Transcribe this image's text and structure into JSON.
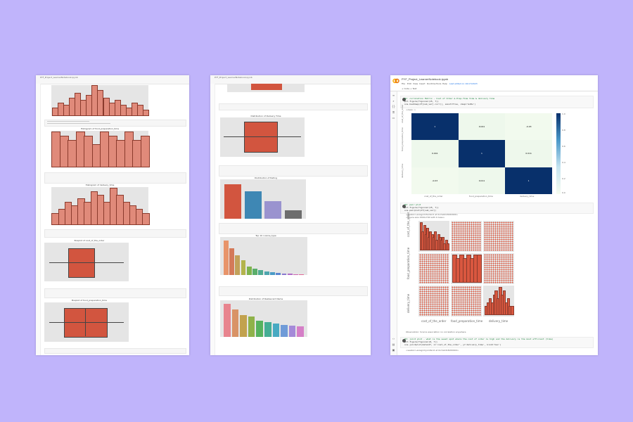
{
  "page1": {
    "title": "PYF_Project_LearnerNotebook.ipynb",
    "chart_titles": [
      "",
      "Histogram of food_preparation_time",
      "Histogram of delivery_time",
      "Boxplot of cost_of_the_order",
      "Boxplot of food_preparation_time"
    ]
  },
  "page2": {
    "title": "PYF_Project_LearnerNotebook.ipynb",
    "chart_titles": [
      "Distribution of Delivery Time",
      "Distribution of Rating",
      "Top 10 cuisine_type",
      "Distribution of Restaurant Name"
    ],
    "rating_bars": {
      "values": [
        88,
        70,
        44,
        22
      ],
      "colors": [
        "#d2553f",
        "#3e87b4",
        "#9a93cf",
        "#6d6d6d"
      ]
    },
    "cuisine_bars": {
      "values": [
        100,
        76,
        56,
        42,
        24,
        18,
        14,
        10,
        8,
        6,
        5,
        4,
        3,
        2
      ],
      "colors": [
        "#e8946a",
        "#d47a59",
        "#c2a25a",
        "#b3b44c",
        "#7fb34d",
        "#5aae6a",
        "#50ab93",
        "#4ea6af",
        "#4a9bc6",
        "#5b86d1",
        "#8a78d0",
        "#b26cc8",
        "#cf65b0",
        "#e06997"
      ]
    },
    "restaurant_bars": {
      "values": [
        100,
        82,
        66,
        62,
        48,
        44,
        40,
        36,
        34,
        32
      ],
      "colors": [
        "#e8848e",
        "#d99366",
        "#c2a24e",
        "#8fb24a",
        "#56b25f",
        "#45ae95",
        "#48aac2",
        "#6f9bd8",
        "#a58ad9",
        "#d57fc7"
      ]
    }
  },
  "notebook": {
    "title": "PYF_Project_LearnerNotebook.ipynb",
    "menu": [
      "File",
      "Edit",
      "View",
      "Insert",
      "Runtime",
      "Tools",
      "Help"
    ],
    "saved": "Last edited on 10/17/2023",
    "toolbar": [
      "+ Code",
      "+ Text"
    ],
    "cell1_lines": [
      "#1: correlation Matrix - Cost of Order & Prep-Time time & delivery time",
      "plt.figure(figsize=(15, 7))",
      "sns.heatmap(df[num_var].corr(), annot=True, cmap='GnBu')"
    ],
    "cell1_output": "<Axes: >",
    "heatmap": {
      "rows": [
        "cost_of_the_order",
        "food_preparation_time",
        "delivery_time"
      ],
      "cols": [
        "cost_of_the_order",
        "food_preparation_time",
        "delivery_time"
      ],
      "values": [
        [
          "1",
          "0.041",
          "-0.03"
        ],
        [
          "0.041",
          "1",
          "0.011"
        ],
        [
          "-0.03",
          "0.011",
          "1"
        ]
      ],
      "scale_ticks": [
        "1.0",
        "0.8",
        "0.6",
        "0.4",
        "0.2",
        "0.0"
      ],
      "colors": {
        "diag": "#08306b",
        "light": "#eef8ec",
        "lighter": "#f2faee"
      }
    },
    "cell2_lines": [
      "#2: pair plot",
      "plt.figure(figsize=(15, 7))",
      "sns.pairplot(df[num_var])"
    ],
    "cell2_output": [
      "<seaborn.axisgrid.PairGrid at 0x7e0d13b8d900>",
      "<Figure size 1500x700 with 0 Axes>"
    ],
    "pair_axes": {
      "x": [
        "cost_of_the_order",
        "food_preparation_time",
        "delivery_time"
      ],
      "y": [
        "cost_of_the_order",
        "food_preparation_time",
        "delivery_time"
      ]
    },
    "observation": "Observation: Scarce association no correlation anywhere",
    "cell3_lines": [
      "#3: joint plot - what is the sweet spot where the cost of order is high and the delivery is the most efficient (time)",
      "plt.figure(figsize=(8, 7))",
      "sns.jointplot(data=df, x='cost_of_the_order', y='delivery_time', kind='hex')"
    ],
    "cell3_output": "<seaborn.axisgrid.JointGrid at 0x7e0d13b8d900>"
  }
}
